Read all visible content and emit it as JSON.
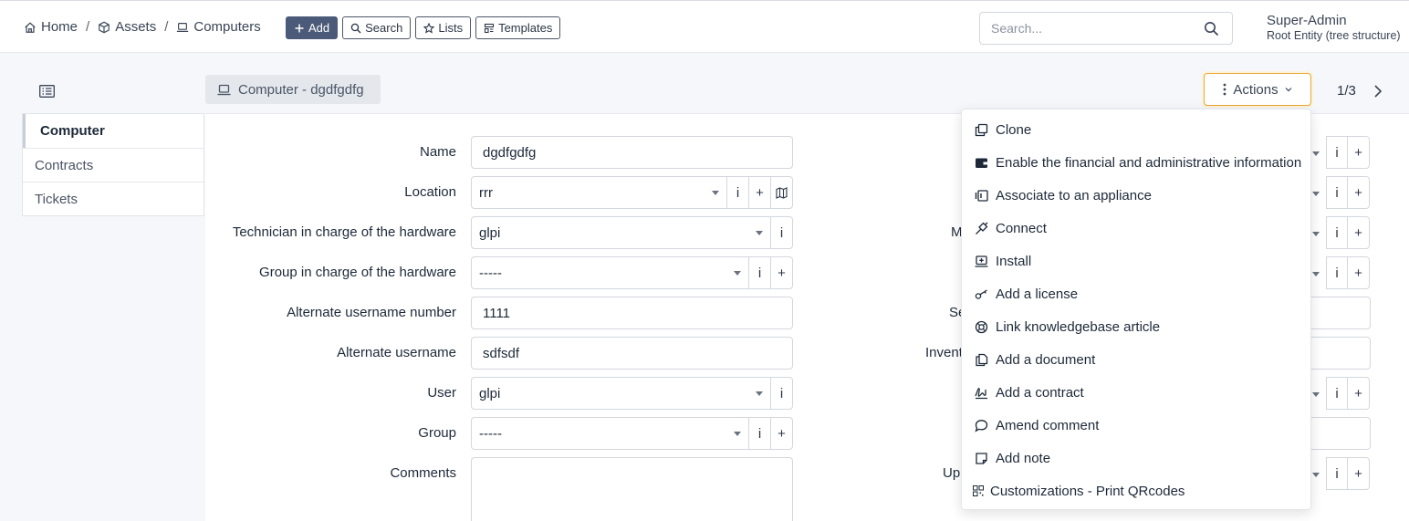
{
  "breadcrumb": [
    {
      "label": "Home",
      "icon": "home-icon"
    },
    {
      "label": "Assets",
      "icon": "box-icon"
    },
    {
      "label": "Computers",
      "icon": "laptop-icon"
    }
  ],
  "toolbar": {
    "add": "Add",
    "search": "Search",
    "lists": "Lists",
    "templates": "Templates"
  },
  "search": {
    "placeholder": "Search..."
  },
  "user": {
    "name": "Super-Admin",
    "entity": "Root Entity (tree structure)"
  },
  "tabs": [
    "Computer",
    "Contracts",
    "Tickets"
  ],
  "item": {
    "title": "Computer - dgdfgdfg"
  },
  "actions": {
    "label": "Actions",
    "pager": "1/3"
  },
  "form": {
    "name": {
      "label": "Name",
      "value": "dgdfgdfg"
    },
    "location": {
      "label": "Location",
      "value": "rrr"
    },
    "tech": {
      "label": "Technician in charge of the hardware",
      "value": "glpi"
    },
    "group_tech": {
      "label": "Group in charge of the hardware",
      "value": "-----"
    },
    "alt_num": {
      "label": "Alternate username number",
      "value": "1111"
    },
    "alt_user": {
      "label": "Alternate username",
      "value": "sdfsdf"
    },
    "user": {
      "label": "User",
      "value": "glpi"
    },
    "group": {
      "label": "Group",
      "value": "-----"
    },
    "comments": {
      "label": "Comments",
      "value": ""
    }
  },
  "right_labels": [
    "M",
    "Se",
    "Invent",
    "Up"
  ],
  "icon_glyphs": {
    "info": "i",
    "plus": "+"
  },
  "menu": [
    {
      "label": "Clone",
      "icon": "clone-icon"
    },
    {
      "label": "Enable the financial and administrative information",
      "icon": "wallet-icon"
    },
    {
      "label": "Associate to an appliance",
      "icon": "appliance-icon"
    },
    {
      "label": "Connect",
      "icon": "plug-icon"
    },
    {
      "label": "Install",
      "icon": "install-icon"
    },
    {
      "label": "Add a license",
      "icon": "key-icon"
    },
    {
      "label": "Link knowledgebase article",
      "icon": "lifebuoy-icon"
    },
    {
      "label": "Add a document",
      "icon": "document-icon"
    },
    {
      "label": "Add a contract",
      "icon": "contract-icon"
    },
    {
      "label": "Amend comment",
      "icon": "comment-icon"
    },
    {
      "label": "Add note",
      "icon": "note-icon"
    },
    {
      "label": "Customizations - Print QRcodes",
      "icon": "qrcode-icon"
    }
  ],
  "colors": {
    "primary": "#4a5a78",
    "actions_border": "#eaa935",
    "background": "#f5f7fb"
  }
}
